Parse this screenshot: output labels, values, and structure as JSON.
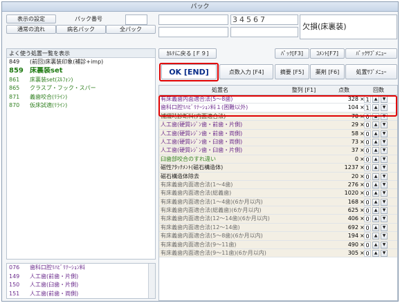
{
  "window": {
    "title": "パック"
  },
  "toolbar": {
    "settings_label": "表示の設定",
    "pack_no_label": "パック番号",
    "normal_flow_label": "通常の流れ",
    "disease_pack_label": "病名パック",
    "all_pack_label": "全パック",
    "code_digits": "34567",
    "status_text": "欠損(床裏装)"
  },
  "actions": {
    "back": "ｶﾙﾃに戻る [Ｆ９]",
    "ok": "OK [END]",
    "pack_f3": "ﾊﾟｯｸ[F3]",
    "comment_f7": "ｺﾒﾝﾄ[F7]",
    "pack_submenu": "ﾊﾟｯｸｻﾌﾞﾒﾆｭｰ",
    "points_input": "点数入力 [F4]",
    "summary_f5": "摘要 [F5]",
    "drug_f6": "薬剤 [F6]",
    "treatment_submenu": "処置ｻﾌﾞﾒﾆｭｰ"
  },
  "left_list": {
    "header": "よく使う処置一覧を表示",
    "items": [
      {
        "code": "849",
        "label": "(前回)床裏装印象(補診+imp)",
        "color": "dark"
      },
      {
        "code": "859",
        "label": "床裏装set",
        "color": "green-bold"
      },
      {
        "code": "861",
        "label": "床裏装set(ｽﾙﾌｫﾝ)",
        "color": "green"
      },
      {
        "code": "865",
        "label": "クラスプ・フック・スパー",
        "color": "green"
      },
      {
        "code": "871",
        "label": "義歯咬合(ﾘﾗｲﾝ)",
        "color": "green"
      },
      {
        "code": "870",
        "label": "仮床試適(ﾘﾗｲﾝ)",
        "color": "green"
      }
    ]
  },
  "bottom_list": {
    "items": [
      {
        "code": "076",
        "label": "歯科口腔ﾘﾊﾋﾞﾘﾃｰｼｮﾝ料"
      },
      {
        "code": "149",
        "label": "人工歯(前歯・片側)"
      },
      {
        "code": "150",
        "label": "人工歯(臼歯・片側)"
      },
      {
        "code": "151",
        "label": "人工歯(前歯・両側)"
      }
    ]
  },
  "table": {
    "headers": {
      "name": "処置名",
      "order": "整列 [F1]",
      "points": "点数",
      "count": "回数"
    },
    "rows": [
      {
        "name": "有床義歯内面適合法(5～8歯)",
        "points": "328",
        "count": "1",
        "color": "purple",
        "bg": "white"
      },
      {
        "name": "歯科口腔ﾘﾊﾋﾞﾘﾃｰｼｮﾝ料１(困難以外)",
        "points": "104",
        "count": "1",
        "color": "purple",
        "bg": "white"
      },
      {
        "name": "補綴時診断料(内面適合法)",
        "points": "70",
        "count": "0",
        "color": "brown",
        "bg": "tan"
      },
      {
        "name": "人工歯(硬質ﾚｼﾞﾝ歯・前歯・片側)",
        "points": "29",
        "count": "0",
        "color": "purple",
        "bg": "tan"
      },
      {
        "name": "人工歯(硬質ﾚｼﾞﾝ歯・前歯・両側)",
        "points": "58",
        "count": "0",
        "color": "purple",
        "bg": "tan"
      },
      {
        "name": "人工歯(硬質ﾚｼﾞﾝ歯・臼歯・両側)",
        "points": "73",
        "count": "0",
        "color": "purple",
        "bg": "tan"
      },
      {
        "name": "人工歯(硬質ﾚｼﾞﾝ歯・臼歯・片側)",
        "points": "37",
        "count": "0",
        "color": "purple",
        "bg": "tan"
      },
      {
        "name": "臼歯部咬合のすれ違い",
        "points": "0",
        "count": "0",
        "color": "green",
        "bg": "tan"
      },
      {
        "name": "磁性ｱﾀｯﾁﾒﾝﾄ(磁石構造体)",
        "points": "1237",
        "count": "0",
        "color": "dark",
        "bg": "tan"
      },
      {
        "name": "磁石構造体除去",
        "points": "20",
        "count": "0",
        "color": "dark",
        "bg": "tan"
      },
      {
        "name": "有床義歯内面適合法(1～4歯)",
        "points": "276",
        "count": "0",
        "color": "gray",
        "bg": "tan"
      },
      {
        "name": "有床義歯内面適合法(総義歯)",
        "points": "1020",
        "count": "0",
        "color": "gray",
        "bg": "tan"
      },
      {
        "name": "有床義歯内面適合法(1～4歯)(6か月以内)",
        "points": "168",
        "count": "0",
        "color": "gray",
        "bg": "tan"
      },
      {
        "name": "有床義歯内面適合法(総義歯)(6か月以内)",
        "points": "625",
        "count": "0",
        "color": "gray",
        "bg": "tan"
      },
      {
        "name": "有床義歯内面適合法(12～14歯)(6か月以内)",
        "points": "406",
        "count": "0",
        "color": "gray",
        "bg": "tan"
      },
      {
        "name": "有床義歯内面適合法(12～14歯)",
        "points": "692",
        "count": "0",
        "color": "gray",
        "bg": "tan"
      },
      {
        "name": "有床義歯内面適合法(5～8歯)(6か月以内)",
        "points": "194",
        "count": "0",
        "color": "gray",
        "bg": "tan"
      },
      {
        "name": "有床義歯内面適合法(9～11歯)",
        "points": "490",
        "count": "0",
        "color": "gray",
        "bg": "tan"
      },
      {
        "name": "有床義歯内面適合法(9～11歯)(6か月以内)",
        "points": "305",
        "count": "0",
        "color": "gray",
        "bg": "tan"
      }
    ]
  },
  "times_symbol": "×",
  "up_glyph": "▲",
  "down_glyph": "▼"
}
